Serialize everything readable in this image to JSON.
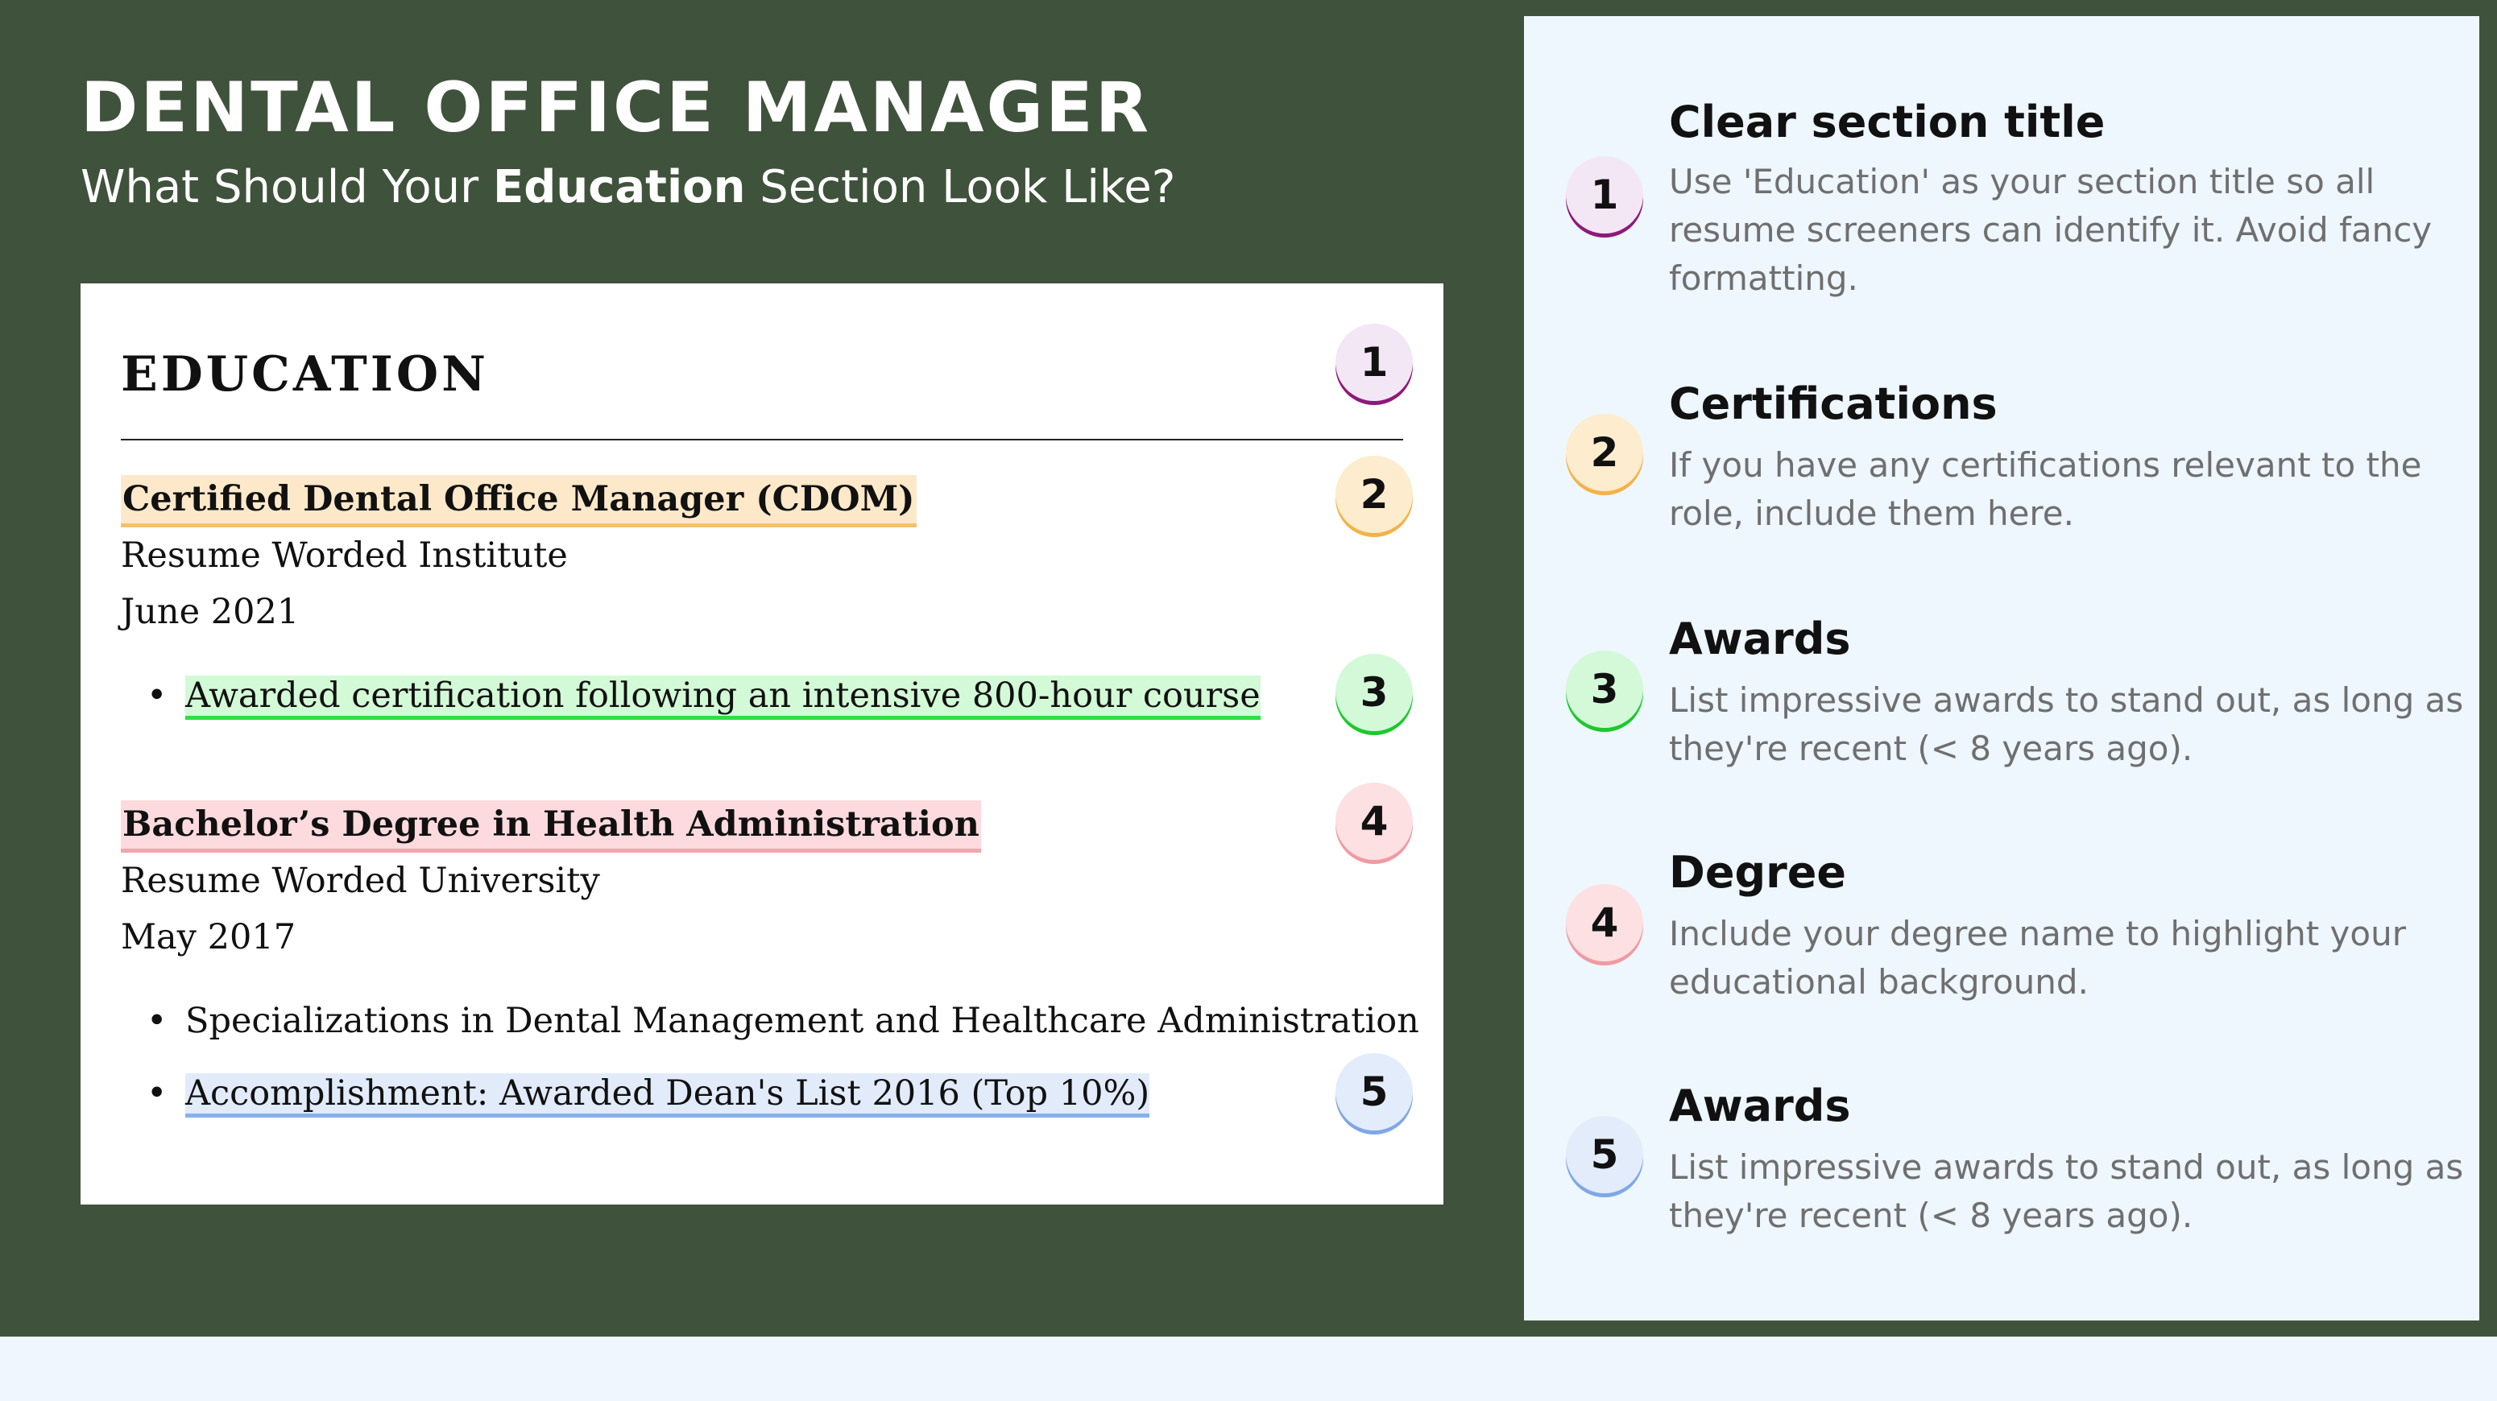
{
  "header": {
    "title": "DENTAL OFFICE MANAGER",
    "subtitle_before": "What Should Your ",
    "subtitle_bold": "Education",
    "subtitle_after": " Section Look Like?"
  },
  "resume": {
    "section_heading": "EDUCATION",
    "entries": [
      {
        "title": "Certified Dental Office Manager (CDOM)",
        "institution": "Resume Worded Institute",
        "date": "June 2021",
        "bullets": [
          "Awarded certification following an intensive 800-hour course"
        ]
      },
      {
        "title": "Bachelor’s Degree in Health Administration",
        "institution": "Resume Worded University",
        "date": "May 2017",
        "bullets": [
          "Specializations in Dental Management and Healthcare Administration",
          "Accomplishment: Awarded Dean's List 2016 (Top 10%)"
        ]
      }
    ],
    "markers": [
      "1",
      "2",
      "3",
      "4",
      "5"
    ]
  },
  "tips": [
    {
      "number": "1",
      "title": "Clear section title",
      "text": "Use 'Education' as your section title so all resume screeners can identify it. Avoid fancy formatting."
    },
    {
      "number": "2",
      "title": "Certifications",
      "text": "If you have any certifications relevant to the role, include them here."
    },
    {
      "number": "3",
      "title": "Awards",
      "text": "List impressive awards to stand out, as long as they're recent (< 8 years ago)."
    },
    {
      "number": "4",
      "title": "Degree",
      "text": "Include your degree name to highlight your educational background."
    },
    {
      "number": "5",
      "title": "Awards",
      "text": "List impressive awards to stand out, as long as they're recent (< 8 years ago)."
    }
  ],
  "colors": {
    "background_green": "#3f523b",
    "panel": "#eef6fe",
    "marker_1": "#8c1a7a",
    "marker_2": "#f3b24a",
    "marker_3": "#1ec82f",
    "marker_4": "#f09aa2",
    "marker_5": "#7ea7e8"
  }
}
